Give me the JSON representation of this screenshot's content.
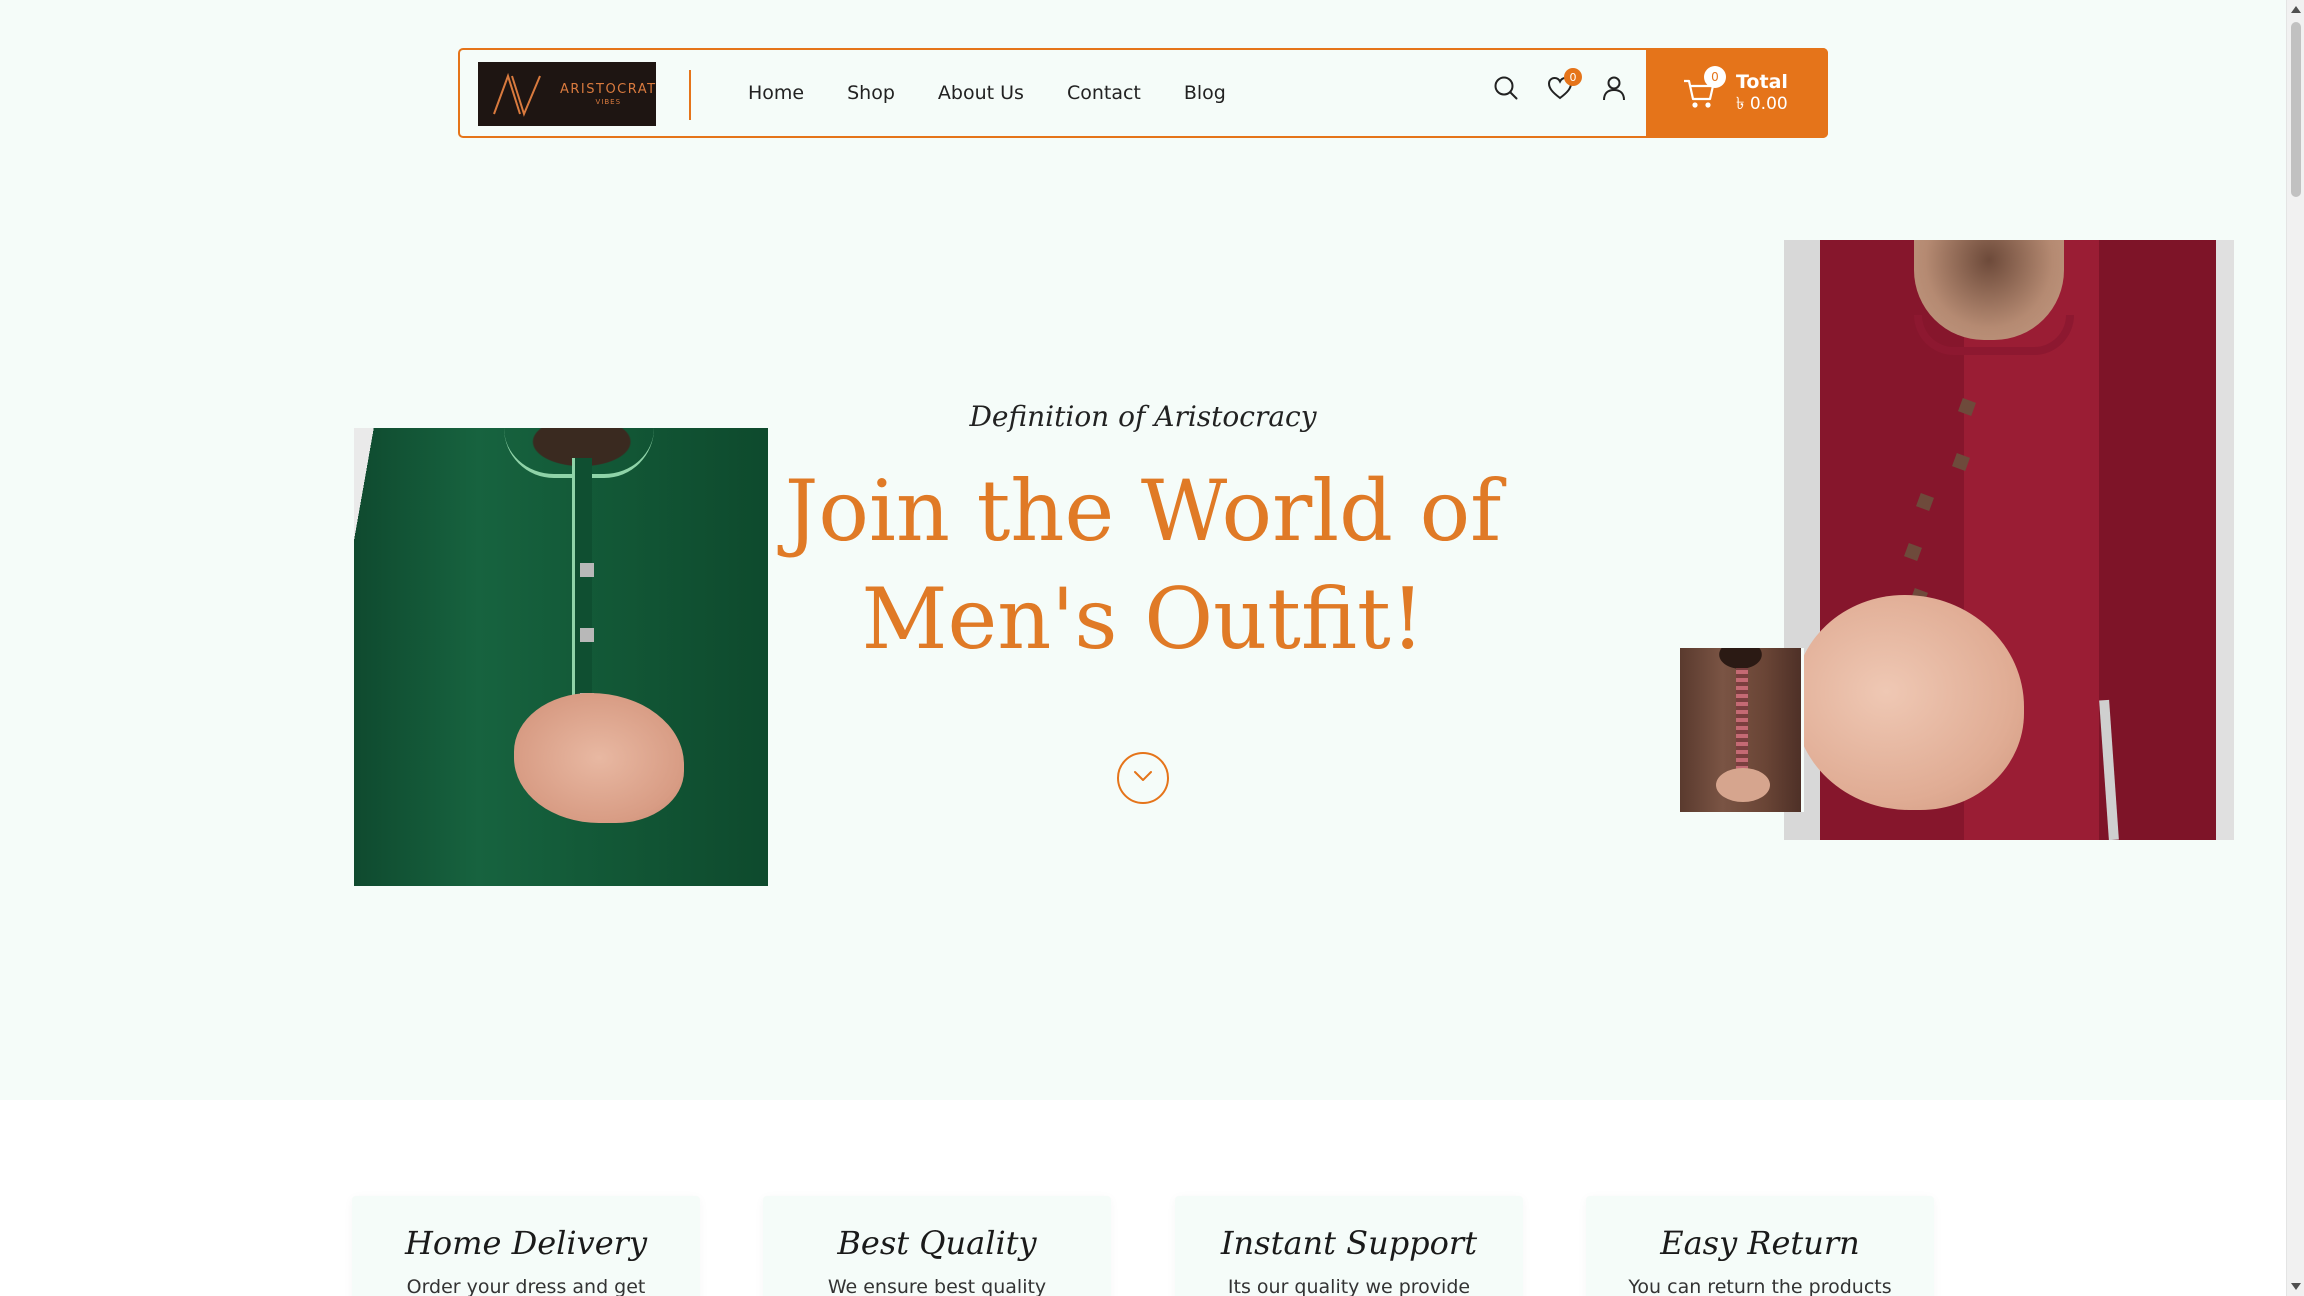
{
  "brand": {
    "logo_name": "ARISTOCRAT",
    "logo_sub": "VIBES"
  },
  "nav": {
    "items": [
      {
        "label": "Home"
      },
      {
        "label": "Shop"
      },
      {
        "label": "About Us"
      },
      {
        "label": "Contact"
      },
      {
        "label": "Blog"
      }
    ]
  },
  "header_icons": {
    "search_icon": "search-icon",
    "wishlist_icon": "heart-icon",
    "wishlist_count": "0",
    "account_icon": "user-icon"
  },
  "cart": {
    "count": "0",
    "label": "Total",
    "amount": "৳ 0.00"
  },
  "hero": {
    "subtitle": "Definition of Aristocracy",
    "title_line1": "Join the World of",
    "title_line2": "Men's Outfit!",
    "scroll_icon": "chevron-down-icon"
  },
  "features": [
    {
      "title": "Home Delivery",
      "desc": "Order your dress and get"
    },
    {
      "title": "Best Quality",
      "desc": "We ensure best quality"
    },
    {
      "title": "Instant Support",
      "desc": "Its our quality we provide"
    },
    {
      "title": "Easy Return",
      "desc": "You can return the products"
    }
  ],
  "colors": {
    "accent": "#e5741a",
    "background": "#f5fcf9",
    "logo_bg": "#1e1512"
  }
}
